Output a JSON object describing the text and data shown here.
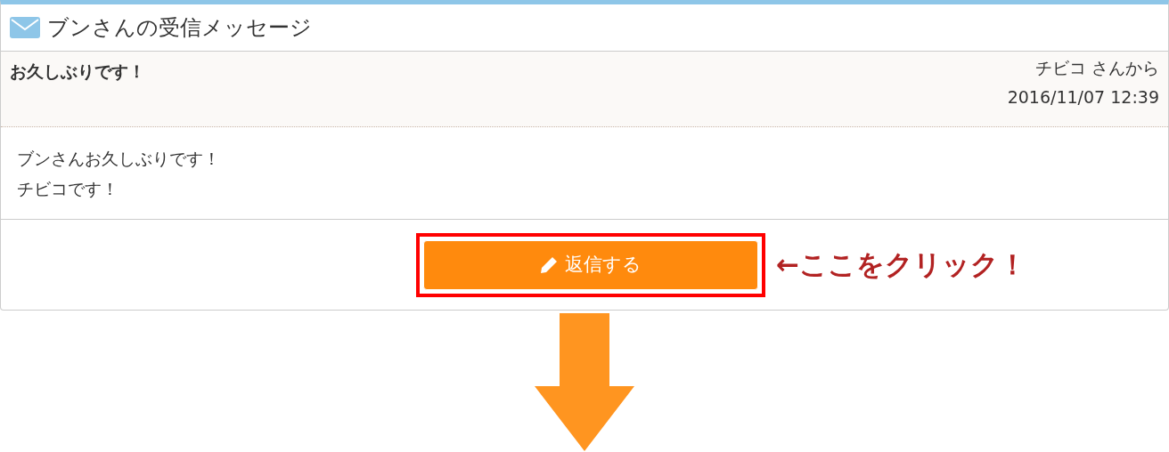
{
  "panel": {
    "title": "ブンさんの受信メッセージ"
  },
  "message": {
    "subject": "お久しぶりです！",
    "sender": "チビコ さんから",
    "date": "2016/11/07 12:39",
    "body_lines": [
      "ブンさんお久しぶりです！",
      "チビコです！"
    ]
  },
  "reply_button": {
    "label": "返信する",
    "highlighted": true
  },
  "annotation": "←ここをクリック！"
}
